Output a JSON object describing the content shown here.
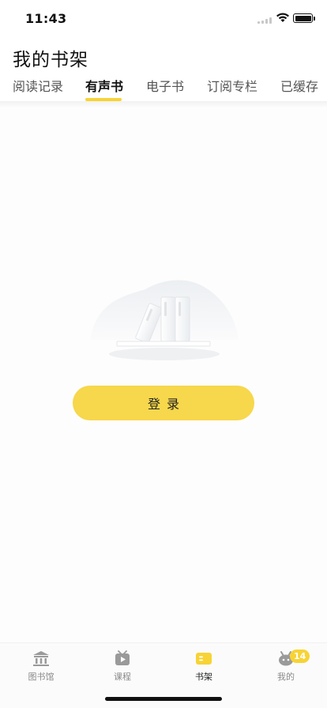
{
  "status_bar": {
    "time": "11:43"
  },
  "header": {
    "title": "我的书架"
  },
  "tabs": [
    {
      "label": "阅读记录",
      "active": false
    },
    {
      "label": "有声书",
      "active": true
    },
    {
      "label": "电子书",
      "active": false
    },
    {
      "label": "订阅专栏",
      "active": false
    },
    {
      "label": "已缓存",
      "active": false
    }
  ],
  "main": {
    "empty_state_icon": "empty-bookshelf-icon",
    "login_label": "登录"
  },
  "bottom_nav": {
    "items": [
      {
        "label": "图书馆",
        "icon": "library-icon",
        "active": false
      },
      {
        "label": "课程",
        "icon": "course-icon",
        "active": false
      },
      {
        "label": "书架",
        "icon": "bookshelf-icon",
        "active": true
      },
      {
        "label": "我的",
        "icon": "profile-icon",
        "active": false,
        "badge": "14"
      }
    ]
  },
  "colors": {
    "accent": "#f7d335",
    "button": "#f7d74b",
    "text": "#222222",
    "muted": "#8a8a8a"
  }
}
